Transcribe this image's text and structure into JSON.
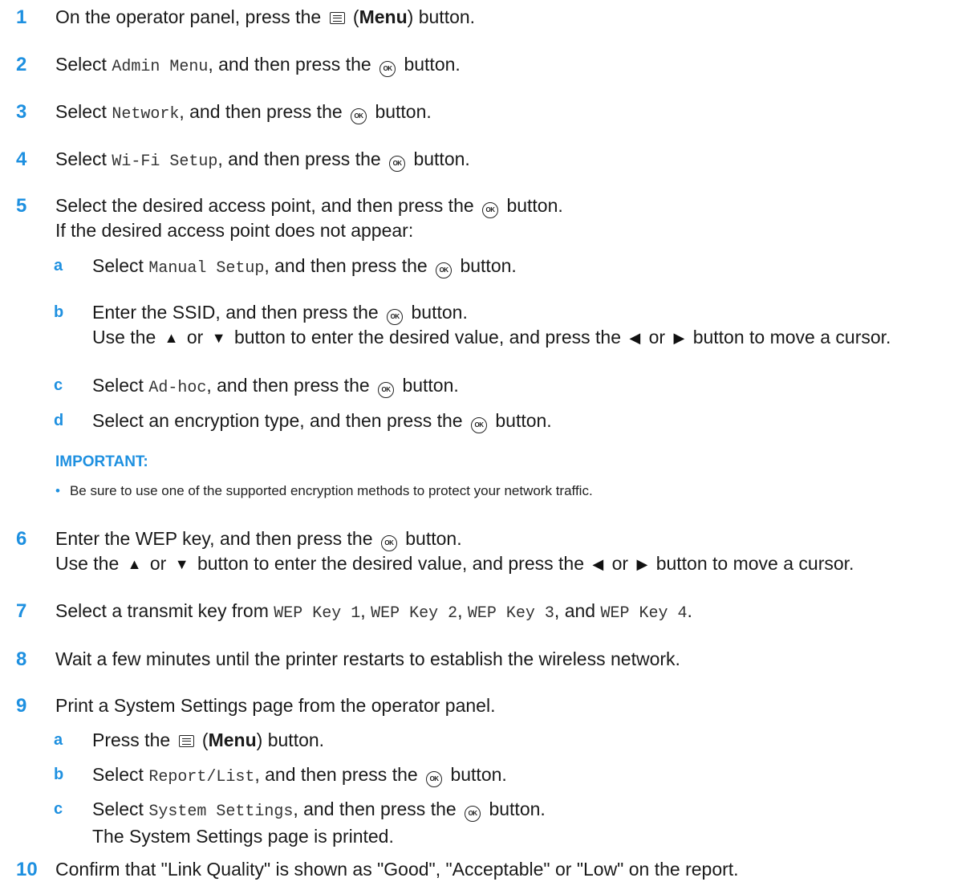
{
  "icons": {
    "ok_label": "OK"
  },
  "steps": {
    "s1": {
      "num": "1",
      "a": "On the operator panel, press the",
      "menu": "Menu",
      "b": ") button."
    },
    "s2": {
      "num": "2",
      "a": "Select",
      "mono": "Admin Menu",
      "b": ", and then press the",
      "c": "button."
    },
    "s3": {
      "num": "3",
      "a": "Select",
      "mono": "Network",
      "b": ", and then press the",
      "c": "button."
    },
    "s4": {
      "num": "4",
      "a": "Select",
      "mono": "Wi-Fi Setup",
      "b": ", and then press the",
      "c": "button."
    },
    "s5": {
      "num": "5",
      "a": "Select the desired access point, and then press the",
      "c": "button.",
      "line2": "If the desired access point does not appear:",
      "sa": {
        "letter": "a",
        "a": "Select",
        "mono": "Manual Setup",
        "b": ", and then press the",
        "c": "button."
      },
      "sb": {
        "letter": "b",
        "a": "Enter the SSID, and then press the",
        "c": "button.",
        "l2a": "Use the",
        "or1": "or",
        "l2b": "button to enter the desired value, and press the",
        "or2": "or",
        "l2c": "button to move a cursor."
      },
      "sc": {
        "letter": "c",
        "a": "Select",
        "mono": "Ad-hoc",
        "b": ", and then press the",
        "c": "button."
      },
      "sd": {
        "letter": "d",
        "a": "Select an encryption type, and then press the",
        "c": "button."
      }
    },
    "important": {
      "label": "IMPORTANT:",
      "bullet": "Be sure to use one of the supported encryption methods to protect your network traffic."
    },
    "s6": {
      "num": "6",
      "a": "Enter the WEP key, and then press the",
      "c": "button.",
      "l2a": "Use the",
      "or1": "or",
      "l2b": "button to enter the desired value, and press the",
      "or2": "or",
      "l2c": "button to move a cursor."
    },
    "s7": {
      "num": "7",
      "a": "Select a transmit key from",
      "k1": "WEP Key 1",
      "k2": "WEP Key 2",
      "k3": "WEP Key 3",
      "and": "and",
      "k4": "WEP Key 4"
    },
    "s8": {
      "num": "8",
      "a": "Wait a few minutes until the printer restarts to establish the wireless network."
    },
    "s9": {
      "num": "9",
      "a": "Print a System Settings page from the operator panel.",
      "sa": {
        "letter": "a",
        "a": "Press the",
        "menu": "Menu",
        "b": ") button."
      },
      "sb": {
        "letter": "b",
        "a": "Select",
        "mono": "Report/List",
        "b": ", and then press the",
        "c": "button."
      },
      "sc": {
        "letter": "c",
        "a": "Select",
        "mono": "System Settings",
        "b": ", and then press the",
        "c": "button.",
        "line2": "The System Settings page is printed."
      }
    },
    "s10": {
      "num": "10",
      "a": "Confirm that \"Link Quality\" is shown as \"Good\", \"Acceptable\" or \"Low\" on the report."
    }
  }
}
